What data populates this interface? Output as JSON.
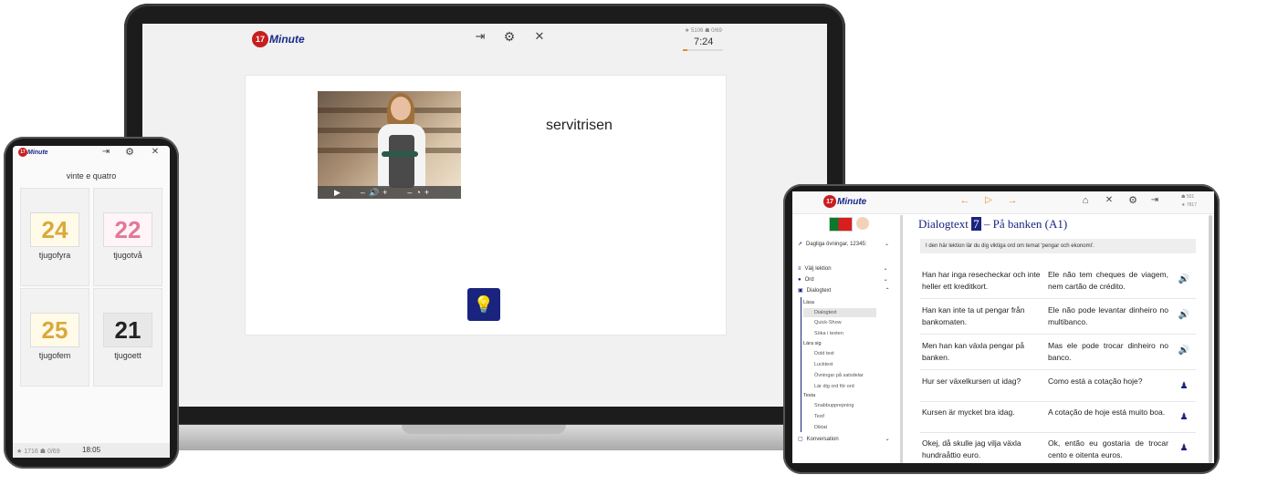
{
  "laptop": {
    "logo_badge": "17",
    "logo_text": "Minute",
    "stats_stars": "★ 5106",
    "stats_hat": "☗ 0/69",
    "timer": "7:24",
    "progress_fraction": 0.12,
    "word": "servitrisen",
    "icons": [
      "exit-icon",
      "gear-icon",
      "mute-icon"
    ],
    "video_controls": {
      "play": "▶",
      "vol_minus": "–",
      "vol_icon": "🔊",
      "vol_plus": "+",
      "speed_minus": "–",
      "speed_icon": "◔",
      "speed_plus": "+"
    },
    "hint_icon": "💡"
  },
  "phone": {
    "logo_badge": "17",
    "logo_text": "Minute",
    "prompt": "vinte e quatro",
    "tiles": [
      {
        "number": "24",
        "label": "tjugofyra",
        "color": "#d9a93a"
      },
      {
        "number": "22",
        "label": "tjugotvå",
        "color": "#e07a96"
      },
      {
        "number": "25",
        "label": "tjugofem",
        "color": "#d9a93a"
      },
      {
        "number": "21",
        "label": "tjugoett",
        "color": "#222222"
      }
    ],
    "footer_stats": "★ 1716 ☗ 0/69",
    "footer_time": "18:05"
  },
  "tablet": {
    "logo_badge": "17",
    "logo_text": "Minute",
    "stats_top": "☗ 501",
    "stats_bottom": "★ 7817",
    "sidebar": {
      "daily": "Dagliga övningar, 12345:",
      "choose_lesson": "Välj lektion",
      "words": "Ord",
      "dialog": "Dialogtext",
      "group_read": "Läsa",
      "read_items": [
        "Dialogtext",
        "Quick-Show",
        "Söka i texten"
      ],
      "group_learn": "Lära sig",
      "learn_items": [
        "Dold text",
        "Lucktext",
        "Övningar på satsdelar",
        "Lär dig ord för ord"
      ],
      "group_test": "Testa",
      "test_items": [
        "Snabbupprepning",
        "Test!",
        "Diktat"
      ],
      "conversation": "Konversation"
    },
    "title_prefix": "Dialogtext",
    "title_number": "7",
    "title_suffix": "– På banken (A1)",
    "intro": "I den här lektion lär du dig viktiga ord om temat 'pengar och ekonomi'.",
    "rows": [
      {
        "sv": "Han har inga resecheckar och inte heller ett kreditkort.",
        "pt": "Ele não tem cheques de viagem, nem cartão de crédito.",
        "icon": "speaker-icon"
      },
      {
        "sv": "Han kan inte ta ut pengar från bankomaten.",
        "pt": "Ele não pode levantar dinheiro no multibanco.",
        "icon": "speaker-icon"
      },
      {
        "sv": "Men han kan växla pengar på banken.",
        "pt": "Mas ele pode trocar dinheiro no banco.",
        "icon": "speaker-icon"
      },
      {
        "sv": "Hur ser växelkursen ut idag?",
        "pt": "Como está a cotação hoje?",
        "icon": "person-icon"
      },
      {
        "sv": "Kursen är mycket bra idag.",
        "pt": "A cotação de hoje está muito boa.",
        "icon": "person-icon"
      },
      {
        "sv": "Okej, då skulle jag vilja växla hundraåttio euro.",
        "pt": "Ok, então eu gostaria de trocar cento e oitenta euros.",
        "icon": "person-icon"
      }
    ]
  }
}
